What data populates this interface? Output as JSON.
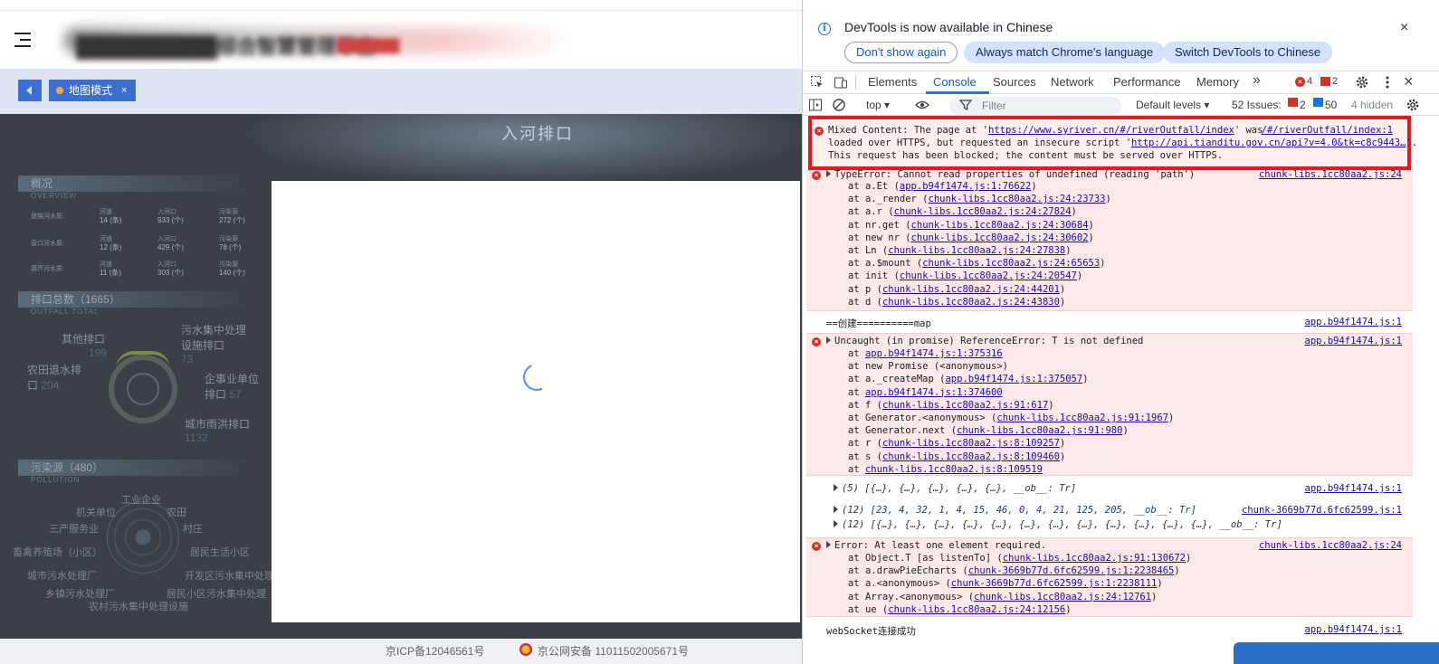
{
  "app": {
    "title": "██████████综合智慧管理平台",
    "subtitle": "███████",
    "tab_label": "地图模式",
    "tab_close": "×",
    "map": {
      "title": "入河排口",
      "overview": {
        "title": "概况",
        "en": "OVERVIEW"
      },
      "stats": [
        {
          "label": "盘锦河水质:",
          "cells": [
            {
              "name": "河道",
              "value": "14 (条)"
            },
            {
              "name": "入河口",
              "value": "933 (个)"
            },
            {
              "name": "污染源",
              "value": "272 (个)"
            }
          ]
        },
        {
          "label": "营口河水质:",
          "cells": [
            {
              "name": "河道",
              "value": "12 (条)"
            },
            {
              "name": "入河口",
              "value": "429 (个)"
            },
            {
              "name": "污染源",
              "value": "78 (个)"
            }
          ]
        },
        {
          "label": "葫芦河水质:",
          "cells": [
            {
              "name": "河道",
              "value": "11 (条)"
            },
            {
              "name": "入河口",
              "value": "303 (个)"
            },
            {
              "name": "污染源",
              "value": "140 (个)"
            }
          ]
        }
      ],
      "outfall_total": {
        "title": "排口总数（1665）",
        "en": "OUTFALL TOTAL"
      },
      "categories": [
        {
          "name": "其他排口",
          "count": "199"
        },
        {
          "name": "污水集中处理设施排口",
          "count": "73"
        },
        {
          "name": "农田退水排口",
          "count": "204"
        },
        {
          "name": "企事业单位排口",
          "count": "57"
        },
        {
          "name": "城市雨洪排口",
          "count": "1132"
        }
      ],
      "pollution": {
        "title": "污染源（480）",
        "en": "POLLUTION"
      },
      "radar_labels": [
        "工业企业",
        "机关单位",
        "农田",
        "三产服务业",
        "村庄",
        "畜禽养殖场（小区）",
        "居民生活小区",
        "城市污水处理厂",
        "开发区污水集中处理",
        "乡镇污水处理厂",
        "居民小区污水集中处理",
        "农村污水集中处理设施"
      ]
    },
    "footer": {
      "icp": "京ICP备12046561号",
      "police": "京公网安备 11011502005671号"
    }
  },
  "devtools": {
    "info": {
      "text": "DevTools is now available in Chinese",
      "btn_dont_show": "Don't show again",
      "btn_match": "Always match Chrome's language",
      "btn_switch": "Switch DevTools to Chinese",
      "close": "×"
    },
    "tabs": [
      "Elements",
      "Console",
      "Sources",
      "Network",
      "Performance",
      "Memory"
    ],
    "active_tab": "Console",
    "more": "»",
    "error_count": "4",
    "warning_count": "2",
    "close": "×",
    "toolbar": {
      "context": "top ▾",
      "filter_placeholder": "Filter",
      "levels": "Default levels ▾",
      "issues_label": "52 Issues:",
      "issues_err": "2",
      "issues_info": "50",
      "hidden": "4 hidden"
    },
    "console": {
      "mixed": {
        "l1a": "Mixed Content: The page at '",
        "l1_link": "https://www.syriver.cn/#/riverOutfall/index",
        "l1b": "' was",
        "l1_src": "/#/riverOutfall/index:1",
        "l2a": "loaded over HTTPS, but requested an insecure script '",
        "l2_link": "http://api.tianditu.gov.cn/api?v=4.0&tk=c8c9443…",
        "l2b": "'.",
        "l3": "This request has been blocked; the content must be served over HTTPS."
      },
      "err1": {
        "head": "TypeError: Cannot read properties of undefined (reading 'path')",
        "src": "chunk-libs.1cc80aa2.js:24",
        "stack": [
          {
            "pre": "at a.Et (",
            "link": "app.b94f1474.js:1:76622",
            "post": ")"
          },
          {
            "pre": "at a._render (",
            "link": "chunk-libs.1cc80aa2.js:24:23733",
            "post": ")"
          },
          {
            "pre": "at a.r (",
            "link": "chunk-libs.1cc80aa2.js:24:27824",
            "post": ")"
          },
          {
            "pre": "at nr.get (",
            "link": "chunk-libs.1cc80aa2.js:24:30684",
            "post": ")"
          },
          {
            "pre": "at new nr (",
            "link": "chunk-libs.1cc80aa2.js:24:30602",
            "post": ")"
          },
          {
            "pre": "at Ln (",
            "link": "chunk-libs.1cc80aa2.js:24:27838",
            "post": ")"
          },
          {
            "pre": "at a.$mount (",
            "link": "chunk-libs.1cc80aa2.js:24:65653",
            "post": ")"
          },
          {
            "pre": "at init (",
            "link": "chunk-libs.1cc80aa2.js:24:20547",
            "post": ")"
          },
          {
            "pre": "at p (",
            "link": "chunk-libs.1cc80aa2.js:24:44201",
            "post": ")"
          },
          {
            "pre": "at d (",
            "link": "chunk-libs.1cc80aa2.js:24:43830",
            "post": ")"
          }
        ]
      },
      "log1": {
        "text": "==创建==========map",
        "src": "app.b94f1474.js:1"
      },
      "err2": {
        "head": "Uncaught (in promise) ReferenceError: T is not defined",
        "src": "app.b94f1474.js:1",
        "stack": [
          {
            "pre": "at ",
            "link": "app.b94f1474.js:1:375316",
            "post": ""
          },
          {
            "pre": "at new Promise (<anonymous>)",
            "link": "",
            "post": ""
          },
          {
            "pre": "at a._createMap (",
            "link": "app.b94f1474.js:1:375057",
            "post": ")"
          },
          {
            "pre": "at ",
            "link": "app.b94f1474.js:1:374600",
            "post": ""
          },
          {
            "pre": "at f (",
            "link": "chunk-libs.1cc80aa2.js:91:617",
            "post": ")"
          },
          {
            "pre": "at Generator.<anonymous> (",
            "link": "chunk-libs.1cc80aa2.js:91:1967",
            "post": ")"
          },
          {
            "pre": "at Generator.next (",
            "link": "chunk-libs.1cc80aa2.js:91:980",
            "post": ")"
          },
          {
            "pre": "at r (",
            "link": "chunk-libs.1cc80aa2.js:8:109257",
            "post": ")"
          },
          {
            "pre": "at s (",
            "link": "chunk-libs.1cc80aa2.js:8:109460",
            "post": ")"
          },
          {
            "pre": "at ",
            "link": "chunk-libs.1cc80aa2.js:8:109519",
            "post": ""
          }
        ]
      },
      "arr1": {
        "count": "(5)",
        "text": "[{…}, {…}, {…}, {…}, {…}, __ob__: Tr]",
        "src": "app.b94f1474.js:1"
      },
      "arr2": {
        "count": "(12)",
        "text": "[23, 4, 32, 1, 4, 15, 46, 0, 4, 21, 125, 205, __ob__: Tr]",
        "src": "chunk-3669b77d.6fc62599.js:1"
      },
      "arr3": {
        "count": "(12)",
        "text": "[{…}, {…}, {…}, {…}, {…}, {…}, {…}, {…}, {…}, {…}, {…}, {…}, __ob__: Tr]"
      },
      "err3": {
        "head": "Error: At least one element required.",
        "src": "chunk-libs.1cc80aa2.js:24",
        "stack": [
          {
            "pre": "at Object.T [as listenTo] (",
            "link": "chunk-libs.1cc80aa2.js:91:130672",
            "post": ")"
          },
          {
            "pre": "at a.drawPieEcharts (",
            "link": "chunk-3669b77d.6fc62599.js:1:2238465",
            "post": ")"
          },
          {
            "pre": "at a.<anonymous> (",
            "link": "chunk-3669b77d.6fc62599.js:1:2238111",
            "post": ")"
          },
          {
            "pre": "at Array.<anonymous> (",
            "link": "chunk-libs.1cc80aa2.js:24:12761",
            "post": ")"
          },
          {
            "pre": "at ue (",
            "link": "chunk-libs.1cc80aa2.js:24:12156",
            "post": ")"
          }
        ]
      },
      "log2": {
        "text": "webSocket连接成功",
        "src": "app.b94f1474.js:1"
      }
    }
  }
}
